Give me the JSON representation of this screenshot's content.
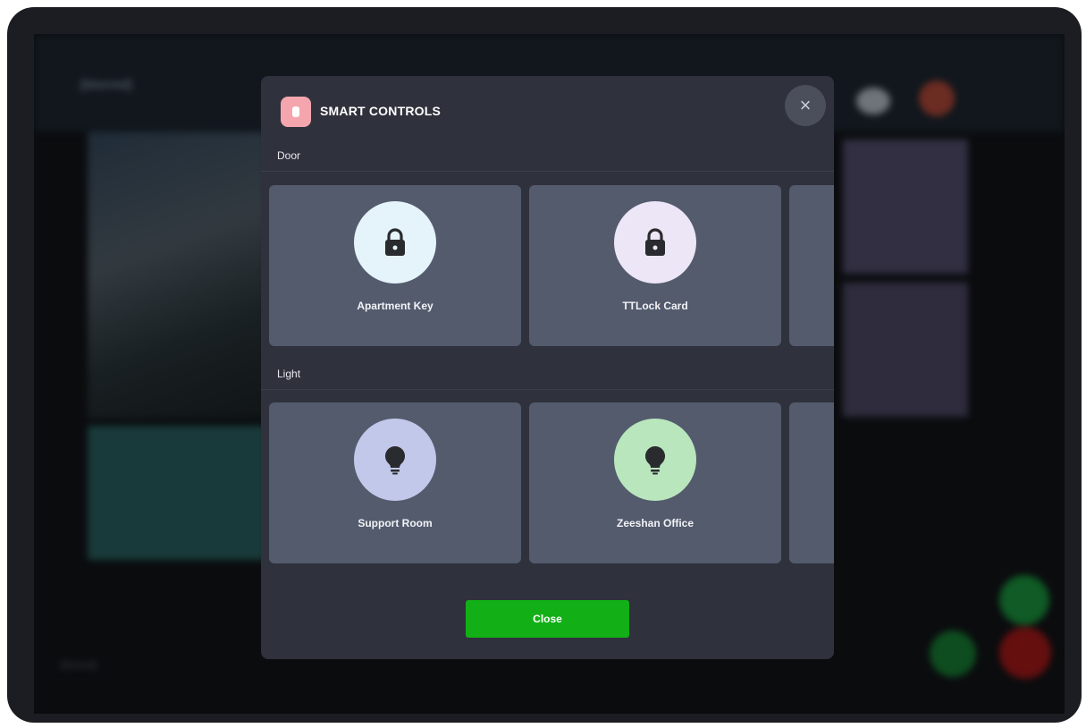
{
  "background": {
    "logo_text": "[blurred]",
    "icons": [
      "cloud-icon",
      "globe-icon"
    ],
    "nav_placeholder": "[blurred]"
  },
  "modal": {
    "title": "SMART CONTROLS",
    "close_icon": "×",
    "sections": [
      {
        "label": "Door",
        "items": [
          {
            "label": "Apartment Key",
            "icon": "lock-icon",
            "icon_bg": "#e5f3fb"
          },
          {
            "label": "TTLock Card",
            "icon": "lock-icon",
            "icon_bg": "#ece6f6"
          }
        ]
      },
      {
        "label": "Light",
        "items": [
          {
            "label": "Support Room",
            "icon": "bulb-icon",
            "icon_bg": "#c2c8ea"
          },
          {
            "label": "Zeeshan Office",
            "icon": "bulb-icon",
            "icon_bg": "#b9e6bc"
          }
        ]
      }
    ],
    "close_button_label": "Close"
  },
  "colors": {
    "accent_green": "#12b016",
    "header_icon_bg": "#f5a5ae"
  }
}
